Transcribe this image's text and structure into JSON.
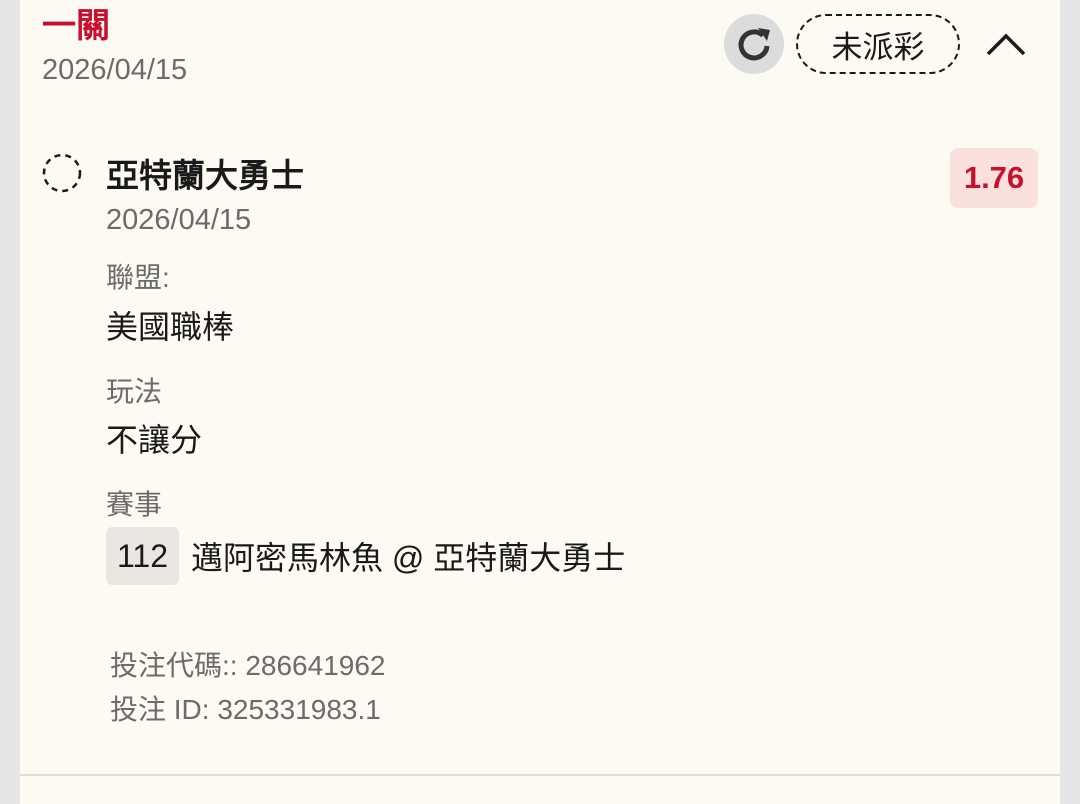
{
  "bet": {
    "type": "一關",
    "date": "2026/04/15",
    "status": "未派彩"
  },
  "selection": {
    "name": "亞特蘭大勇士",
    "date": "2026/04/15",
    "odds": "1.76"
  },
  "fields": {
    "league_label": "聯盟:",
    "league_value": "美國職棒",
    "market_label": "玩法",
    "market_value": "不讓分",
    "event_label": "賽事",
    "event_number": "112",
    "event_name": "邁阿密馬林魚 @ 亞特蘭大勇士"
  },
  "footer": {
    "bet_code": "投注代碼:: 286641962",
    "bet_id": "投注 ID: 325331983.1"
  },
  "icons": {
    "refresh": "refresh-icon",
    "collapse": "chevron-up-icon",
    "pending": "pending-circle-icon"
  },
  "colors": {
    "accent": "#c8102e",
    "odds_bg": "#fbe1de",
    "card_bg": "#fdfaf3"
  }
}
